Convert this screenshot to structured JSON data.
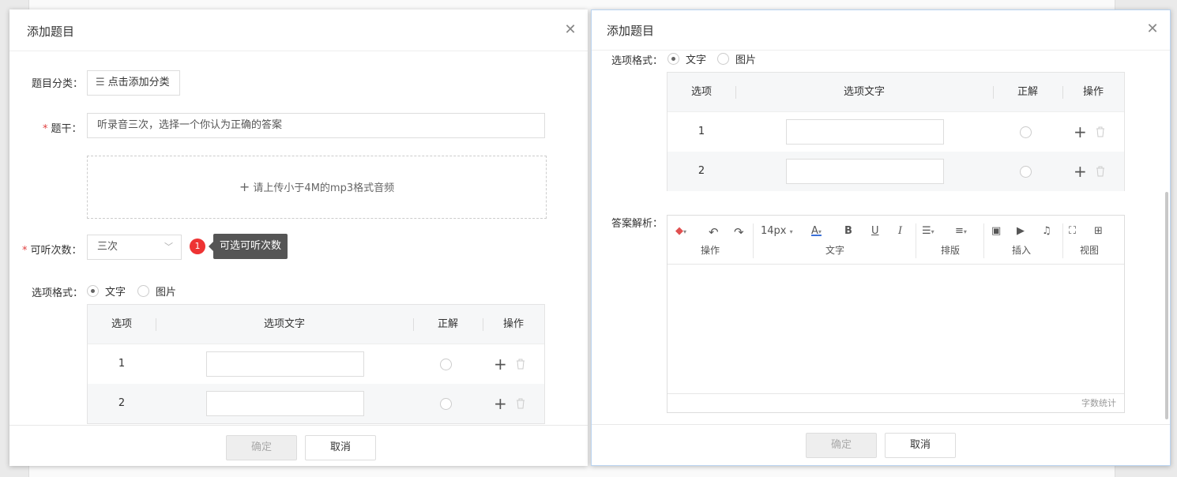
{
  "left": {
    "title": "添加题目",
    "category_label": "题目分类：",
    "category_button": "点击添加分类",
    "stem_label": "题干：",
    "stem_value": "听录音三次，选择一个你认为正确的答案",
    "upload_text": "请上传小于4M的mp3格式音频",
    "listen_label": "可听次数：",
    "listen_value": "三次",
    "badge": "1",
    "tooltip": "可选可听次数",
    "format_label": "选项格式：",
    "format_text": "文字",
    "format_image": "图片",
    "table": {
      "headers": [
        "选项",
        "选项文字",
        "正解",
        "操作"
      ],
      "rows": [
        "1",
        "2"
      ]
    },
    "ok": "确定",
    "cancel": "取消"
  },
  "right": {
    "title": "添加题目",
    "format_label": "选项格式：",
    "format_text": "文字",
    "format_image": "图片",
    "table": {
      "headers": [
        "选项",
        "选项文字",
        "正解",
        "操作"
      ],
      "rows": [
        "1",
        "2"
      ]
    },
    "analysis_label": "答案解析：",
    "toolbar": {
      "font_size": "14px",
      "groups": [
        "操作",
        "文字",
        "排版",
        "插入",
        "视图"
      ]
    },
    "word_count": "字数统计",
    "ok": "确定",
    "cancel": "取消"
  }
}
